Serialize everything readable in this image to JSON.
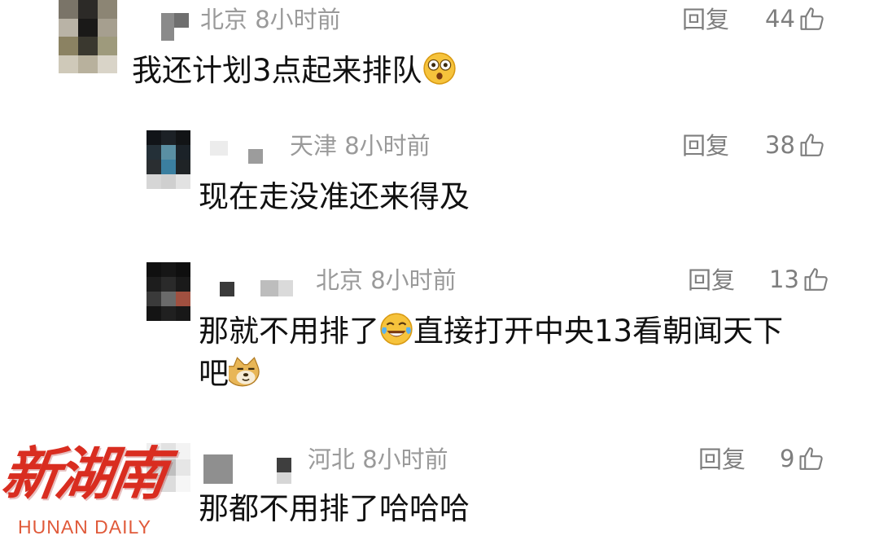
{
  "comments": [
    {
      "location_time": "北京 8小时前",
      "reply": "回复",
      "likes": "44",
      "text_parts": [
        "我还计划3点起来排队"
      ],
      "emoji": "shocked-face-emoji"
    },
    {
      "location_time": "天津 8小时前",
      "reply": "回复",
      "likes": "38",
      "text_parts": [
        "现在走没准还来得及"
      ]
    },
    {
      "location_time": "北京 8小时前",
      "reply": "回复",
      "likes": "13",
      "text_parts": [
        "那就不用排了",
        "直接打开中央13看朝闻天下",
        "吧"
      ],
      "emojis": [
        "laughing-tears-emoji",
        "doge-emoji"
      ]
    },
    {
      "location_time": "河北 8小时前",
      "reply": "回复",
      "likes": "9",
      "text_parts": [
        "那都不用排了哈哈哈"
      ]
    }
  ],
  "watermark": {
    "chinese": "新湖南",
    "english": "HUNAN DAILY"
  },
  "colors": {
    "meta_gray": "#9a9a9a",
    "action_gray": "#7e7e7e",
    "text": "#111111",
    "watermark_red": "#d92d20"
  },
  "icons": {
    "like": "thumbs-up-icon"
  }
}
